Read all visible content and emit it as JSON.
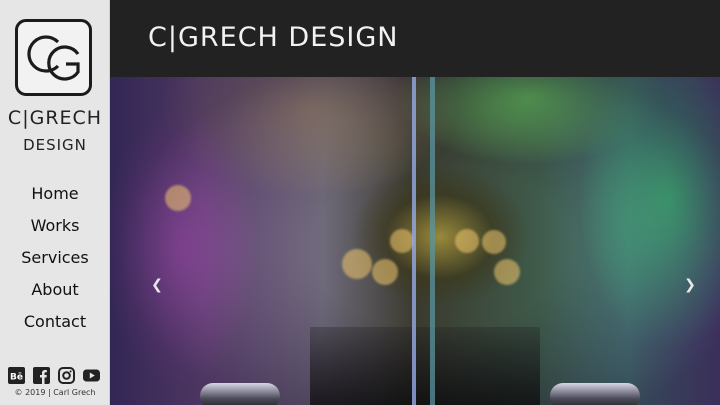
{
  "brand": {
    "logo_icon": "cg-monogram-logo",
    "name_line1": "C|GRECH",
    "name_line2": "DESIGN"
  },
  "nav": {
    "items": [
      {
        "label": "Home"
      },
      {
        "label": "Works"
      },
      {
        "label": "Services"
      },
      {
        "label": "About"
      },
      {
        "label": "Contact"
      }
    ]
  },
  "socials": [
    {
      "icon": "behance-icon"
    },
    {
      "icon": "facebook-icon"
    },
    {
      "icon": "instagram-icon"
    },
    {
      "icon": "youtube-icon"
    }
  ],
  "footer": {
    "copyright": "© 2019 | Carl Grech"
  },
  "header": {
    "title": "C|GRECH DESIGN"
  },
  "slider": {
    "prev_icon": "chevron-left-icon",
    "next_icon": "chevron-right-icon"
  },
  "colors": {
    "header_bg": "#222222",
    "sidebar_bg": "#e6e6e6",
    "text_dark": "#111111"
  }
}
